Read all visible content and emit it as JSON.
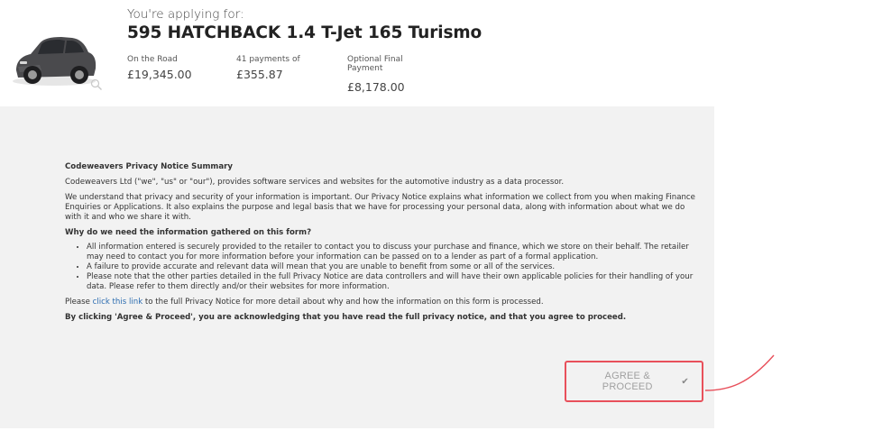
{
  "header": {
    "applying_label": "You're applying for:",
    "model_name": "595 HATCHBACK 1.4 T-Jet 165 Turismo",
    "car_image_icon": "car-thumbnail-image",
    "zoom_icon": "magnifier-icon",
    "stats": [
      {
        "label": "On the Road",
        "value": "£19,345.00"
      },
      {
        "label": "41 payments of",
        "value": "£355.87"
      },
      {
        "label": "Optional Final Payment",
        "value": "£8,178.00"
      }
    ]
  },
  "notice": {
    "title": "Codeweavers Privacy Notice Summary",
    "intro": "Codeweavers Ltd (\"we\", \"us\" or \"our\"), provides software services and websites for the automotive industry as a data processor.",
    "understand": "We understand that privacy and security of your information is important. Our Privacy Notice explains what information we collect from you when making Finance Enquiries or Applications. It also explains the purpose and legal basis that we have for processing your personal data, along with information about what we do with it and who we share it with.",
    "question": "Why do we need the information gathered on this form?",
    "bullets": [
      "All information entered is securely provided to the retailer to contact you to discuss your purchase and finance, which we store on their behalf. The retailer may need to contact you for more information before your information can be passed on to a lender as part of a formal application.",
      "A failure to provide accurate and relevant data will mean that you are unable to benefit from some or all of the services.",
      "Please note that the other parties detailed in the full Privacy Notice are data controllers and will have their own applicable policies for their handling of your data. Please refer to them directly and/or their websites for more information."
    ],
    "link_prefix": "Please ",
    "link_text": "click this link",
    "link_suffix": " to the full Privacy Notice for more detail about why and how the information on this form is processed.",
    "acknowledge": "By clicking 'Agree & Proceed', you are acknowledging that you have read the full privacy notice, and that you agree to proceed."
  },
  "actions": {
    "agree_label": "AGREE & PROCEED",
    "agree_icon": "check-icon",
    "highlight_color": "#e8505b"
  }
}
